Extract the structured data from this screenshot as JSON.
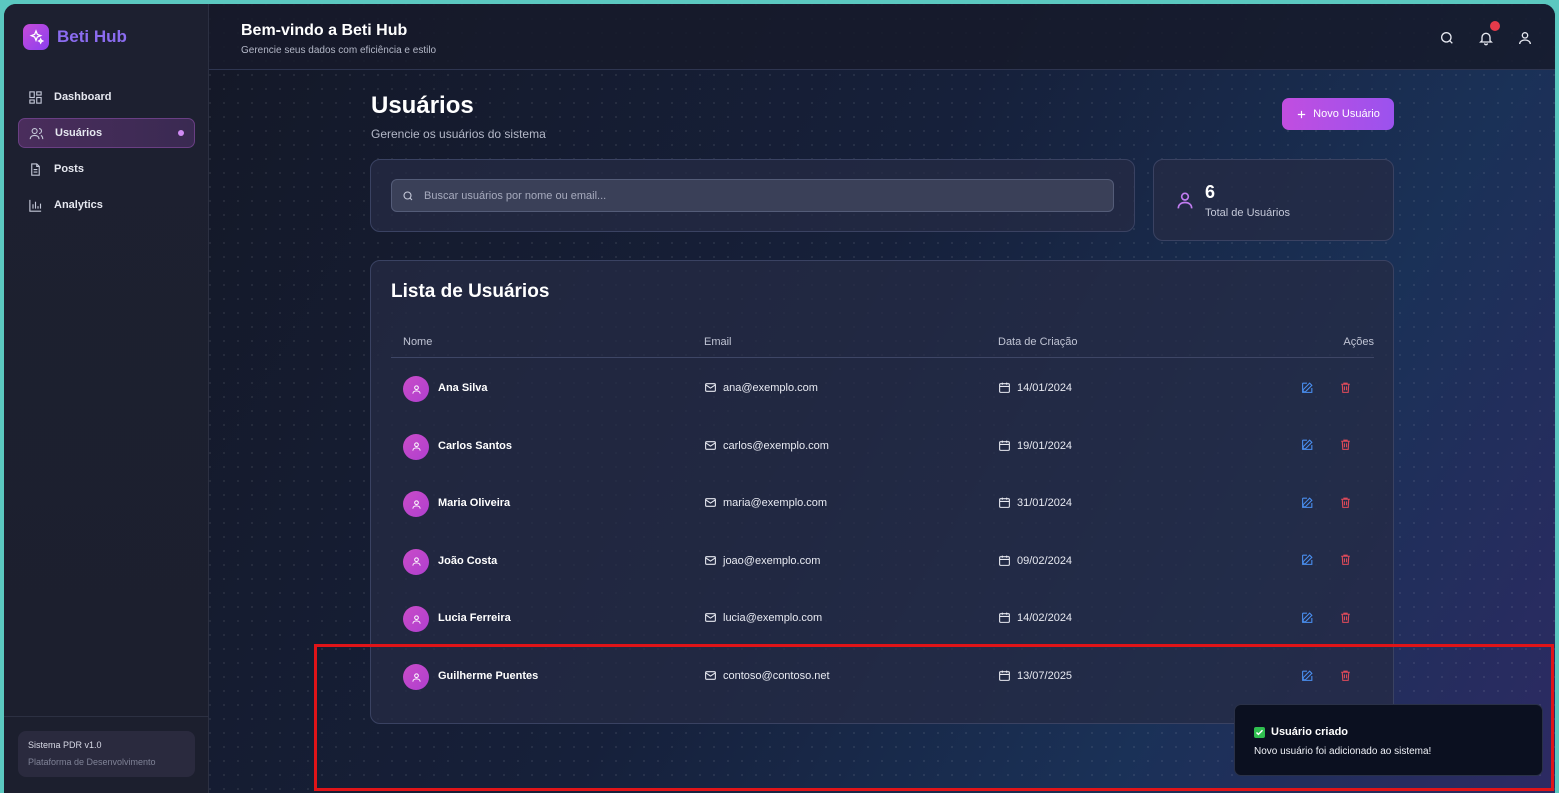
{
  "brand": {
    "name": "Beti Hub"
  },
  "sidebar": {
    "items": [
      {
        "label": "Dashboard",
        "icon": "dashboard-icon"
      },
      {
        "label": "Usuários",
        "icon": "users-icon",
        "active": true
      },
      {
        "label": "Posts",
        "icon": "document-icon"
      },
      {
        "label": "Analytics",
        "icon": "bar-chart-icon"
      }
    ],
    "system_title": "Sistema PDR v1.0",
    "system_subtitle": "Plataforma de Desenvolvimento"
  },
  "header": {
    "title": "Bem-vindo a Beti Hub",
    "subtitle": "Gerencie seus dados com eficiência e estilo",
    "icons": [
      "search-icon",
      "bell-icon",
      "user-icon"
    ]
  },
  "page": {
    "title": "Usuários",
    "subtitle": "Gerencie os usuários do sistema",
    "new_button": "Novo Usuário"
  },
  "search": {
    "placeholder": "Buscar usuários por nome ou email..."
  },
  "stats": {
    "total_value": "6",
    "total_label": "Total de Usuários"
  },
  "table": {
    "title": "Lista de Usuários",
    "columns": [
      "Nome",
      "Email",
      "Data de Criação",
      "Ações"
    ],
    "rows": [
      {
        "name": "Ana Silva",
        "email": "ana@exemplo.com",
        "date": "14/01/2024"
      },
      {
        "name": "Carlos Santos",
        "email": "carlos@exemplo.com",
        "date": "19/01/2024"
      },
      {
        "name": "Maria Oliveira",
        "email": "maria@exemplo.com",
        "date": "31/01/2024"
      },
      {
        "name": "João Costa",
        "email": "joao@exemplo.com",
        "date": "09/02/2024"
      },
      {
        "name": "Lucia Ferreira",
        "email": "lucia@exemplo.com",
        "date": "14/02/2024"
      },
      {
        "name": "Guilherme Puentes",
        "email": "contoso@contoso.net",
        "date": "13/07/2025"
      }
    ]
  },
  "toast": {
    "title": "Usuário criado",
    "message": "Novo usuário foi adicionado ao sistema!"
  },
  "colors": {
    "accent": "#b54fe6",
    "danger": "#e04a5a",
    "edit": "#4a8ff0"
  }
}
